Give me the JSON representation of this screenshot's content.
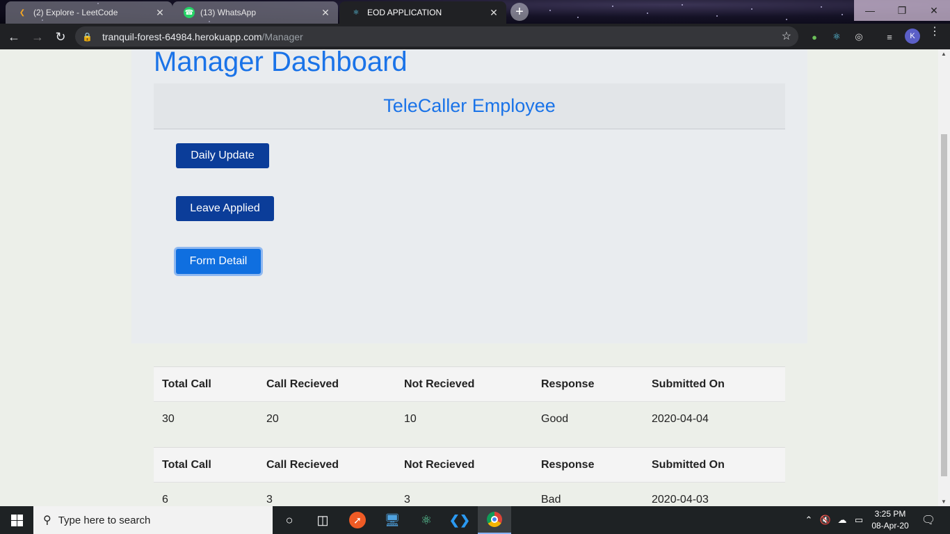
{
  "browser": {
    "tabs": [
      {
        "label": "(2) Explore - LeetCode",
        "icon": "leetcode-icon",
        "active": false
      },
      {
        "label": "(13) WhatsApp",
        "icon": "whatsapp-icon",
        "active": false
      },
      {
        "label": "EOD APPLICATION",
        "icon": "react-icon",
        "active": true
      }
    ],
    "url_host": "tranquil-forest-64984.herokuapp.com",
    "url_path": "/Manager",
    "profile_initial": "K"
  },
  "page": {
    "title": "Manager Dashboard",
    "section_header": "TeleCaller Employee",
    "buttons": {
      "daily_update": "Daily Update",
      "leave_applied": "Leave Applied",
      "form_detail": "Form Detail"
    }
  },
  "records": [
    {
      "headers": [
        "Total Call",
        "Call Recieved",
        "Not Recieved",
        "Response",
        "Submitted On"
      ],
      "values": [
        "30",
        "20",
        "10",
        "Good",
        "2020-04-04"
      ]
    },
    {
      "headers": [
        "Total Call",
        "Call Recieved",
        "Not Recieved",
        "Response",
        "Submitted On"
      ],
      "values": [
        "6",
        "3",
        "3",
        "Bad",
        "2020-04-03"
      ]
    }
  ],
  "taskbar": {
    "search_placeholder": "Type here to search",
    "time": "3:25 PM",
    "date": "08-Apr-20"
  },
  "colors": {
    "accent_blue": "#1a73e8",
    "button_dark": "#0b3d99",
    "button_focused": "#0f6fe0"
  }
}
